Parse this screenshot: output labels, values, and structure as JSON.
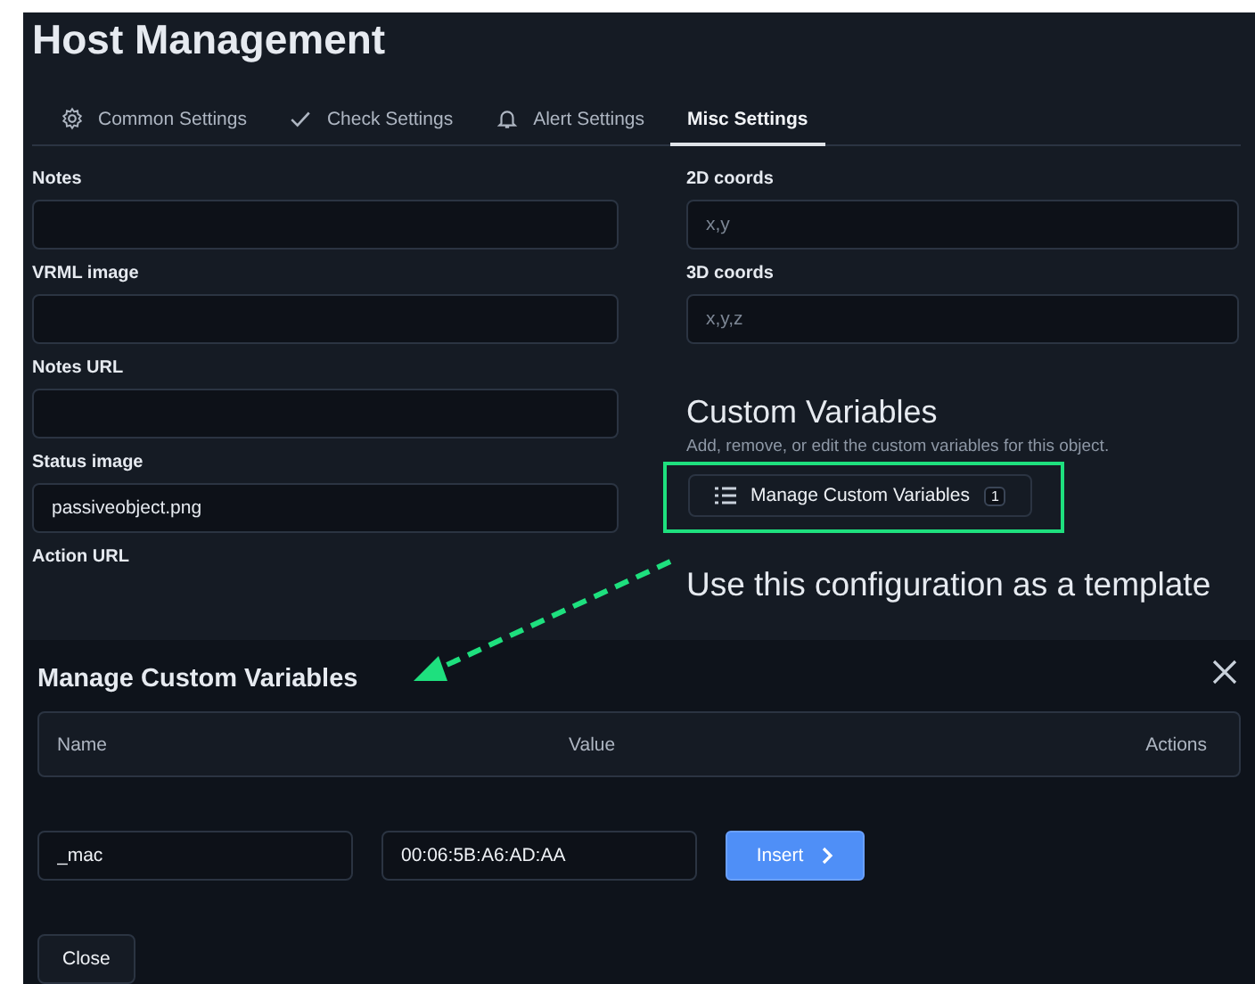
{
  "page": {
    "title": "Host Management"
  },
  "tabs": [
    {
      "label": "Common Settings",
      "kind": "gear",
      "selected": false
    },
    {
      "label": "Check Settings",
      "kind": "check",
      "selected": false
    },
    {
      "label": "Alert Settings",
      "kind": "bell",
      "selected": false
    },
    {
      "label": "Misc Settings",
      "kind": "none",
      "selected": true
    }
  ],
  "left_fields": [
    {
      "label": "Notes"
    },
    {
      "label": "VRML image"
    },
    {
      "label": "Notes URL"
    },
    {
      "label": "Status image",
      "value": "passiveobject.png"
    },
    {
      "label": "Action URL"
    }
  ],
  "right_fields": [
    {
      "label": "2D coords",
      "placeholder": "x,y"
    },
    {
      "label": "3D coords",
      "placeholder": "x,y,z"
    }
  ],
  "custom_variables": {
    "heading": "Custom Variables",
    "description": "Add, remove, or edit the custom variables for this object.",
    "button": "Manage Custom Variables",
    "count": "1"
  },
  "template_heading": "Use this configuration as a template",
  "modal": {
    "title": "Manage Custom Variables",
    "columns": [
      "Name",
      "Value",
      "Actions"
    ],
    "name_value": "_mac",
    "value_value": "00:06:5B:A6:AD:AA",
    "insert_button": "Insert",
    "close_button": "Close"
  }
}
